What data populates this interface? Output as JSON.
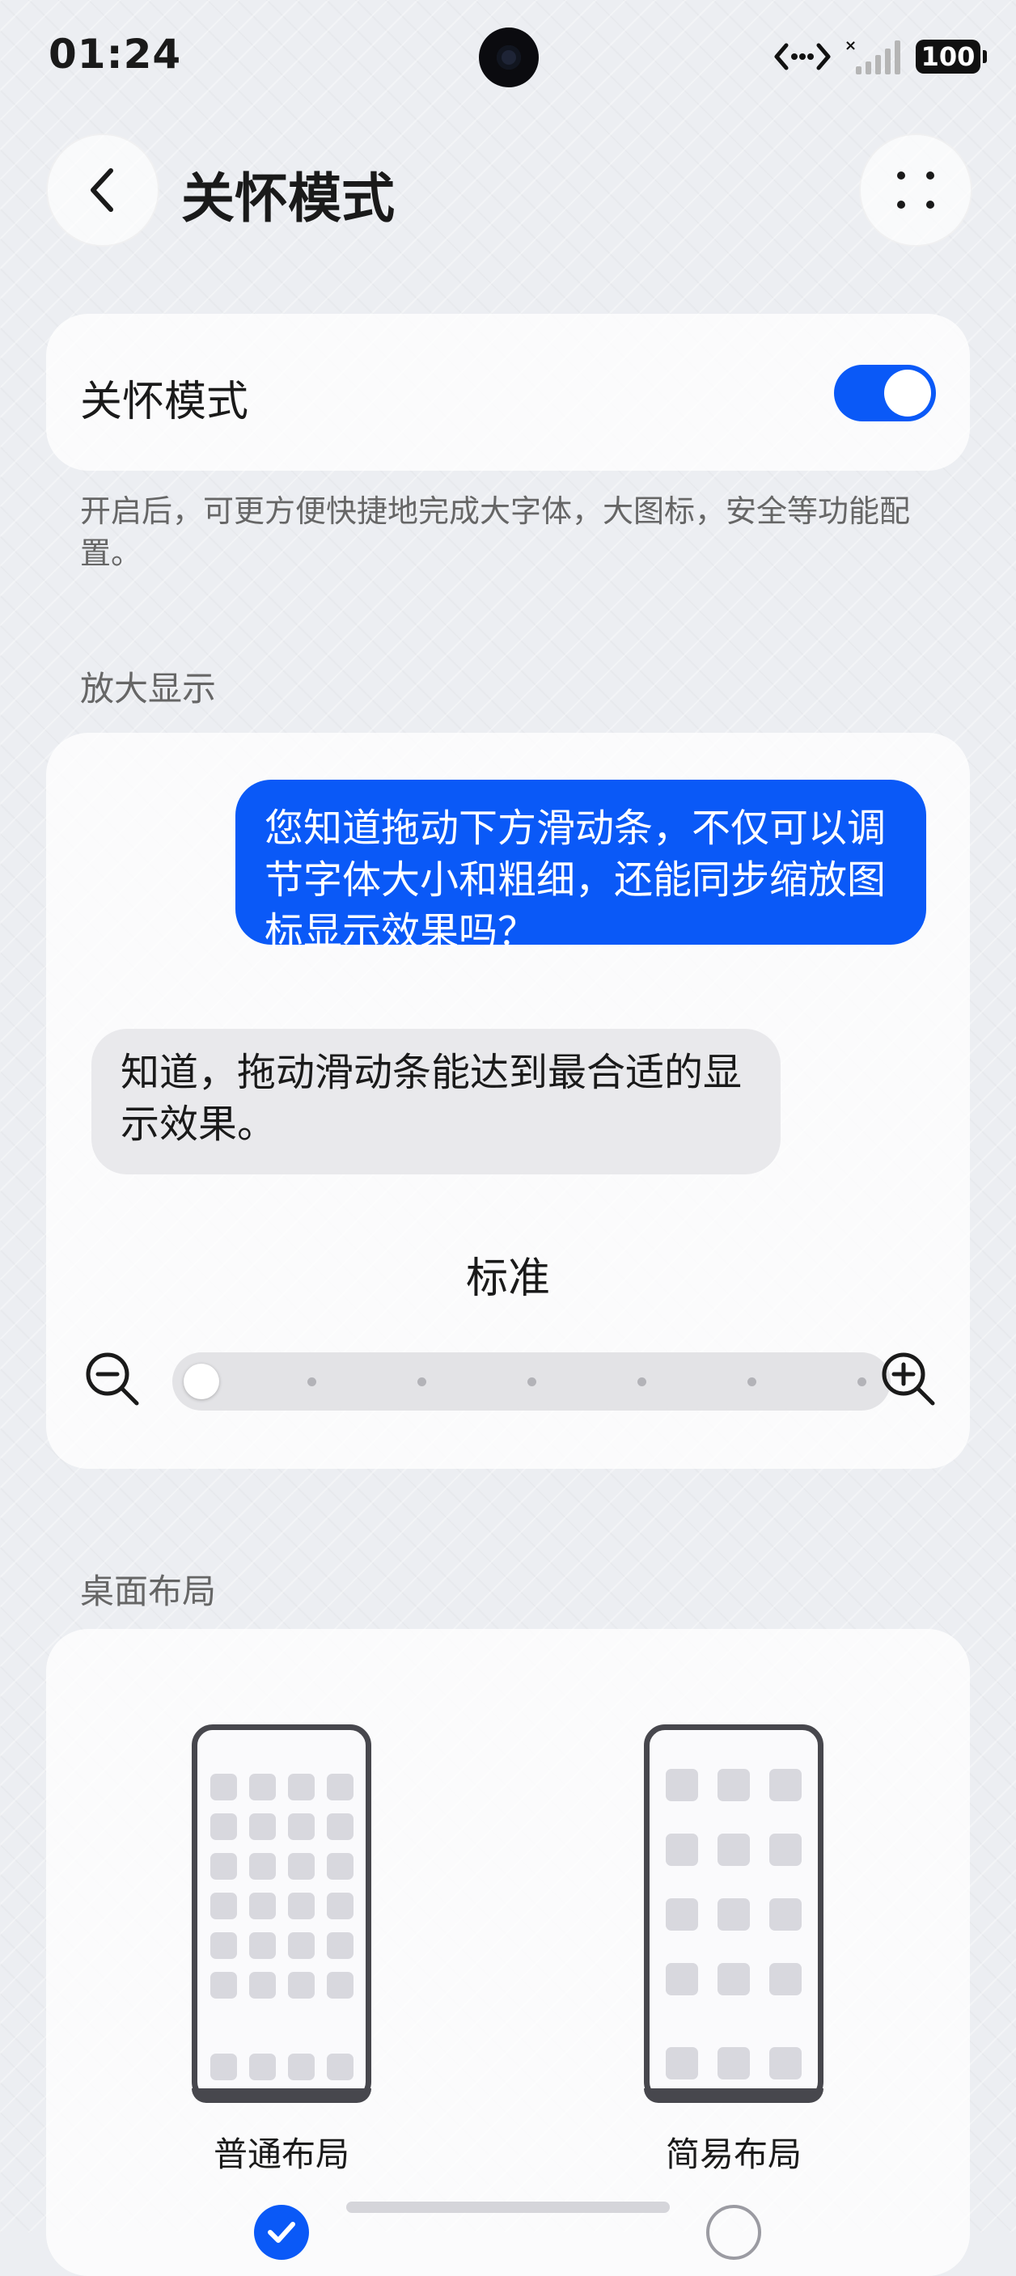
{
  "status_bar": {
    "time": "01:24",
    "battery": "100",
    "icons": [
      "data-transfer-icon",
      "signal-icon",
      "battery-icon"
    ]
  },
  "header": {
    "title": "关怀模式",
    "back_icon": "chevron-left-icon",
    "more_icon": "more-dots-icon"
  },
  "care_mode": {
    "label": "关怀模式",
    "enabled": true,
    "description": "开启后，可更方便快捷地完成大字体，大图标，安全等功能配置。"
  },
  "zoom": {
    "section_title": "放大显示",
    "sent_message": "您知道拖动下方滑动条，不仅可以调节字体大小和粗细，还能同步缩放图标显示效果吗？",
    "received_message": "知道，拖动滑动条能达到最合适的显示效果。",
    "current_size": "标准",
    "slider_level": 0,
    "slider_steps": 7
  },
  "desktop_layout": {
    "section_title": "桌面布局",
    "options": [
      {
        "label": "普通布局",
        "selected": true
      },
      {
        "label": "简易布局",
        "selected": false
      }
    ]
  },
  "colors": {
    "accent": "#0a59f7",
    "background": "#eceef2",
    "card": "#ffffff",
    "secondary_text": "#666666"
  }
}
